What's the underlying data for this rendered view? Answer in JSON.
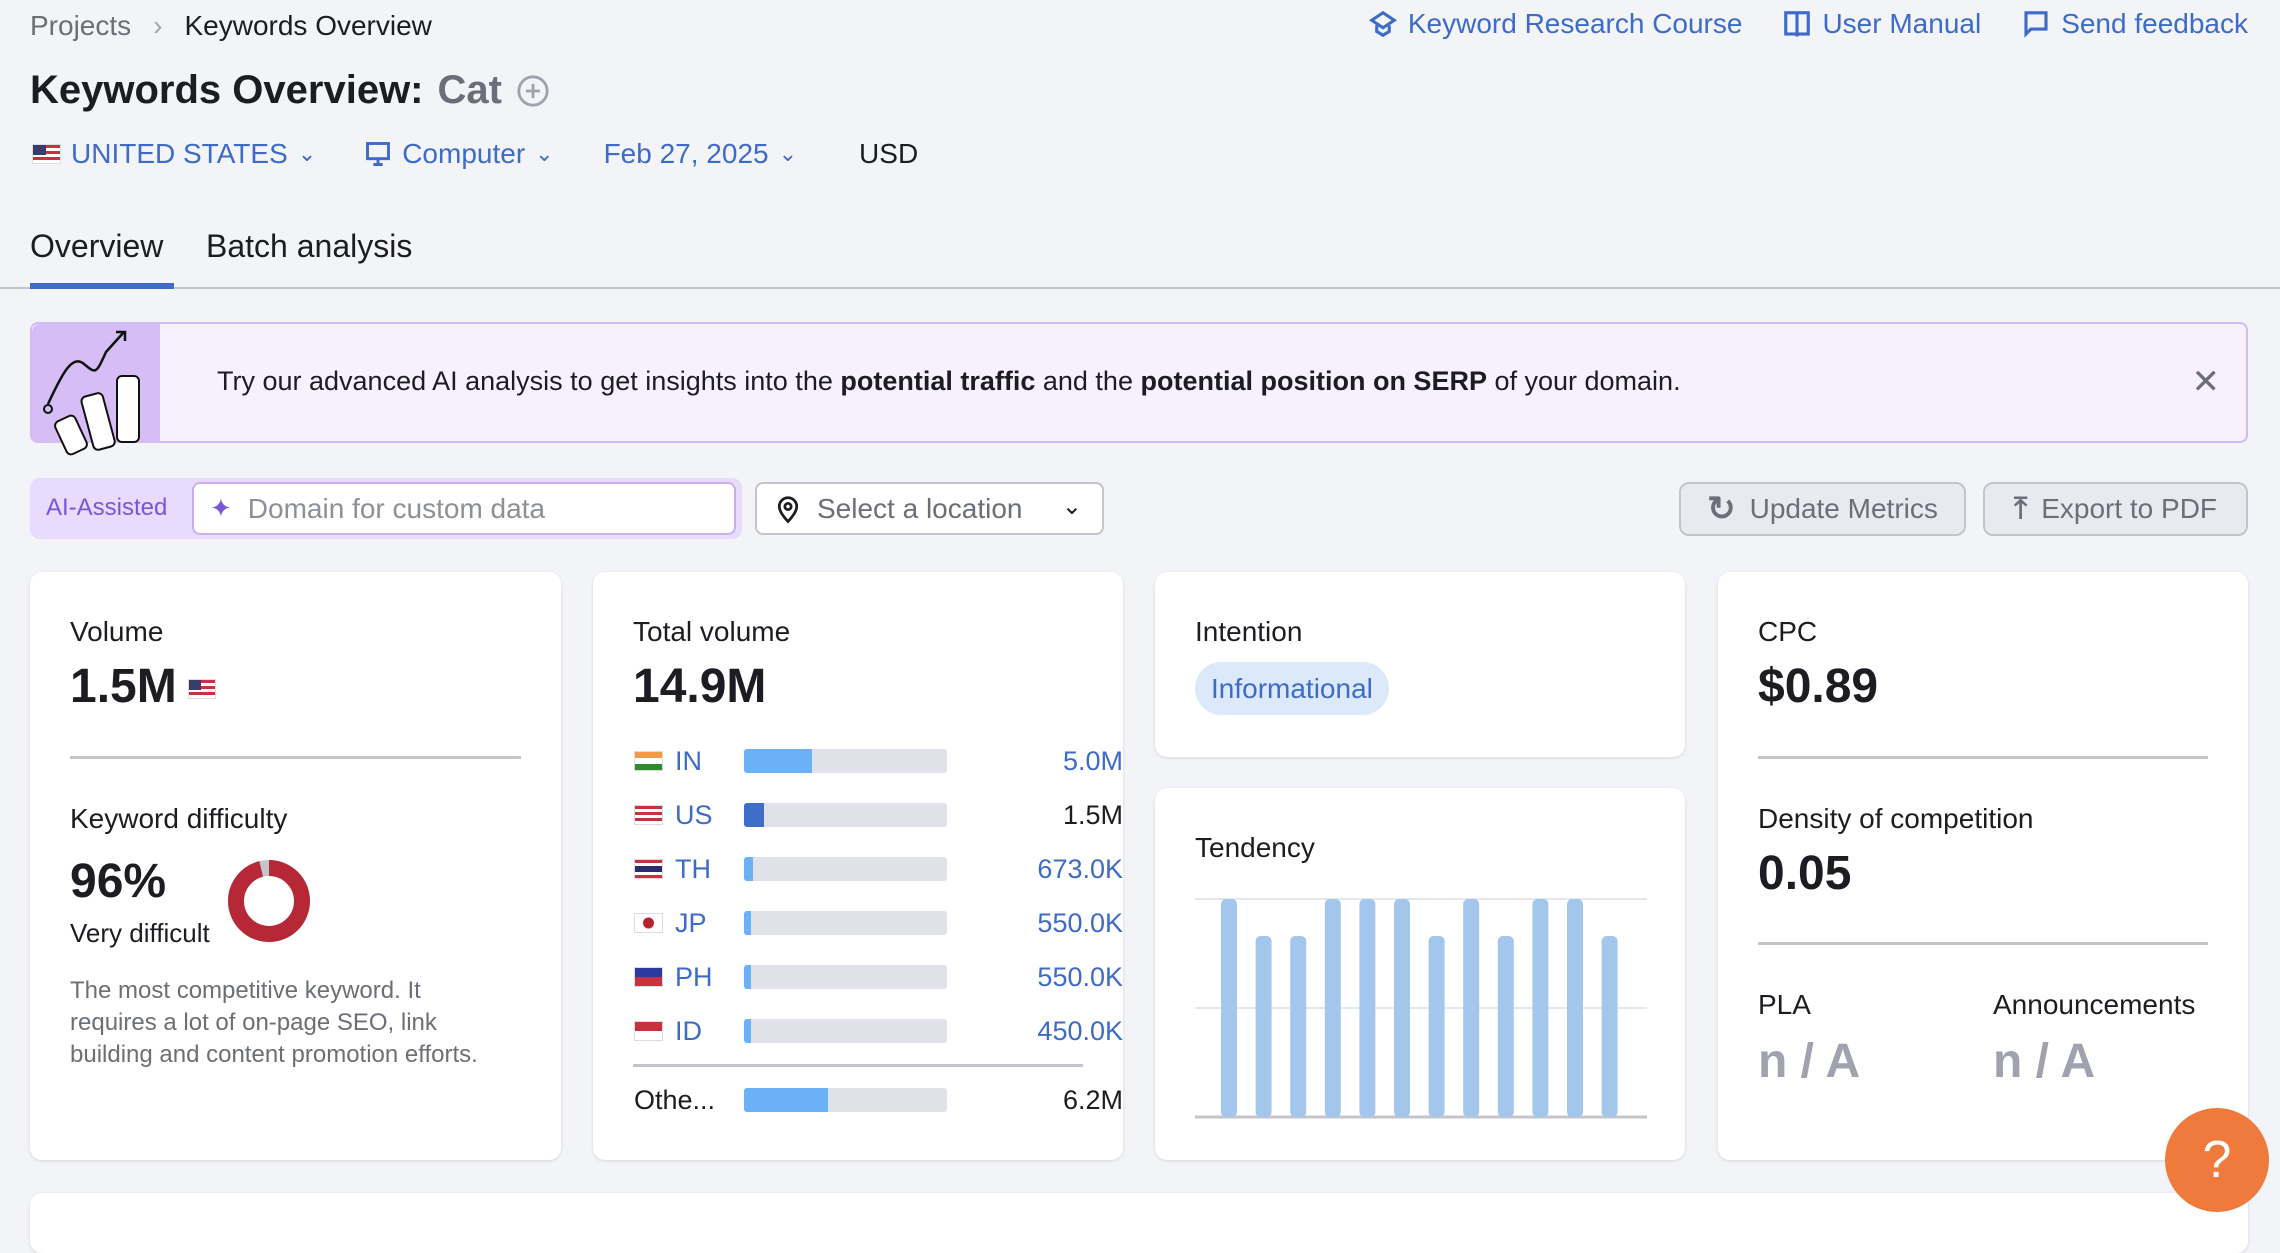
{
  "breadcrumb": {
    "items": [
      "Projects",
      "Keywords Overview"
    ]
  },
  "header_links": [
    {
      "label": "Keyword Research Course",
      "icon": "graduation-cap-icon"
    },
    {
      "label": "User Manual",
      "icon": "book-icon"
    },
    {
      "label": "Send feedback",
      "icon": "chat-bubble-icon"
    }
  ],
  "title": {
    "prefix": "Keywords Overview:",
    "keyword": "Cat"
  },
  "filters": {
    "country": "UNITED STATES",
    "device": "Computer",
    "date": "Feb 27, 2025",
    "currency": "USD"
  },
  "tabs": [
    {
      "label": "Overview",
      "active": true
    },
    {
      "label": "Batch analysis",
      "active": false
    }
  ],
  "banner": {
    "text_1": "Try our advanced AI analysis to get insights into the ",
    "bold_1": "potential traffic",
    "text_2": " and the ",
    "bold_2": "potential position on SERP",
    "text_3": " of your domain."
  },
  "ai_row": {
    "badge": "AI-Assisted",
    "domain_placeholder": "Domain for custom data",
    "location_placeholder": "Select a location"
  },
  "actions": {
    "update": "Update Metrics",
    "export": "Export to PDF"
  },
  "volume": {
    "label": "Volume",
    "value": "1.5M"
  },
  "difficulty": {
    "label": "Keyword difficulty",
    "value": "96%",
    "percent": 96,
    "level": "Very difficult",
    "description_lines": [
      "The most competitive keyword. It",
      "requires a lot of on-page SEO, link",
      "building and content promotion efforts."
    ],
    "color": "#b72837"
  },
  "total_volume": {
    "label": "Total volume",
    "value": "14.9M",
    "total": 14900000,
    "countries": [
      {
        "code": "IN",
        "value": "5.0M",
        "num": 5000000,
        "fill": "#6bb1f7",
        "link": true
      },
      {
        "code": "US",
        "value": "1.5M",
        "num": 1500000,
        "fill": "#3f6ec9",
        "link": false
      },
      {
        "code": "TH",
        "value": "673.0K",
        "num": 673000,
        "fill": "#6bb1f7",
        "link": true
      },
      {
        "code": "JP",
        "value": "550.0K",
        "num": 550000,
        "fill": "#6bb1f7",
        "link": true
      },
      {
        "code": "PH",
        "value": "550.0K",
        "num": 550000,
        "fill": "#6bb1f7",
        "link": true
      },
      {
        "code": "ID",
        "value": "450.0K",
        "num": 450000,
        "fill": "#6bb1f7",
        "link": true
      }
    ],
    "other": {
      "label": "Othe...",
      "value": "6.2M",
      "num": 6200000
    }
  },
  "intention": {
    "label": "Intention",
    "badge": "Informational"
  },
  "tendency": {
    "label": "Tendency",
    "values": [
      1,
      0.83,
      0.83,
      1,
      1,
      1,
      0.83,
      1,
      0.83,
      1,
      1,
      0.83
    ],
    "color": "#a3c7ec"
  },
  "cpc": {
    "label": "CPC",
    "value": "$0.89"
  },
  "density": {
    "label": "Density of competition",
    "value": "0.05"
  },
  "pla": {
    "label": "PLA",
    "value": "n / A"
  },
  "announcements": {
    "label": "Announcements",
    "value": "n / A"
  },
  "help": {
    "label": "?"
  }
}
